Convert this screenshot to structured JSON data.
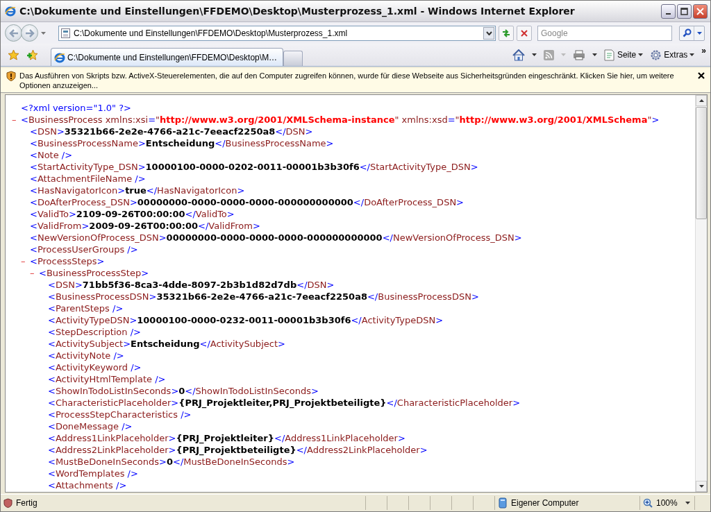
{
  "window": {
    "title": "C:\\Dokumente und Einstellungen\\FFDEMO\\Desktop\\Musterprozess_1.xml - Windows Internet Explorer"
  },
  "address_bar": {
    "value": "C:\\Dokumente und Einstellungen\\FFDEMO\\Desktop\\Musterprozess_1.xml"
  },
  "search": {
    "placeholder": "Google"
  },
  "tabs": [
    {
      "label": "C:\\Dokumente und Einstellungen\\FFDEMO\\Desktop\\M…",
      "selected": true
    }
  ],
  "command_bar": {
    "page_menu": "Seite",
    "tools_menu": "Extras",
    "overflow": "»"
  },
  "info_bar": {
    "message": "Das Ausführen von Skripts bzw. ActiveX-Steuerelementen, die auf den Computer zugreifen können, wurde für diese Webseite aus Sicherheitsgründen eingeschränkt. Klicken Sie hier, um weitere Optionen anzuzeigen..."
  },
  "xml": {
    "declaration": "<?xml version=\"1.0\" ?>",
    "root": {
      "toggle": "–",
      "expanded": true,
      "segments": [
        {
          "kind": "markup",
          "text": "<BusinessProcess xmlns:xsi=\""
        },
        {
          "kind": "attr_value",
          "text": "http://www.w3.org/2001/XMLSchema-instance"
        },
        {
          "kind": "markup",
          "text": "\" xmlns:xsd=\""
        },
        {
          "kind": "attr_value",
          "text": "http://www.w3.org/2001/XMLSchema"
        },
        {
          "kind": "markup",
          "text": "\">"
        }
      ],
      "children": [
        {
          "segments": [
            {
              "kind": "markup",
              "text": "<DSN>"
            },
            {
              "kind": "text",
              "text": "35321b66-2e2e-4766-a21c-7eeacf2250a8"
            },
            {
              "kind": "markup",
              "text": "</DSN>"
            }
          ]
        },
        {
          "segments": [
            {
              "kind": "markup",
              "text": "<BusinessProcessName>"
            },
            {
              "kind": "text",
              "text": "Entscheidung"
            },
            {
              "kind": "markup",
              "text": "</BusinessProcessName>"
            }
          ]
        },
        {
          "segments": [
            {
              "kind": "markup",
              "text": "<Note />"
            }
          ]
        },
        {
          "segments": [
            {
              "kind": "markup",
              "text": "<StartActivityType_DSN>"
            },
            {
              "kind": "text",
              "text": "10000100-0000-0202-0011-00001b3b30f6"
            },
            {
              "kind": "markup",
              "text": "</StartActivityType_DSN>"
            }
          ]
        },
        {
          "segments": [
            {
              "kind": "markup",
              "text": "<AttachmentFileName />"
            }
          ]
        },
        {
          "segments": [
            {
              "kind": "markup",
              "text": "<HasNavigatorIcon>"
            },
            {
              "kind": "text",
              "text": "true"
            },
            {
              "kind": "markup",
              "text": "</HasNavigatorIcon>"
            }
          ]
        },
        {
          "segments": [
            {
              "kind": "markup",
              "text": "<DoAfterProcess_DSN>"
            },
            {
              "kind": "text",
              "text": "00000000-0000-0000-0000-000000000000"
            },
            {
              "kind": "markup",
              "text": "</DoAfterProcess_DSN>"
            }
          ]
        },
        {
          "segments": [
            {
              "kind": "markup",
              "text": "<ValidTo>"
            },
            {
              "kind": "text",
              "text": "2109-09-26T00:00:00"
            },
            {
              "kind": "markup",
              "text": "</ValidTo>"
            }
          ]
        },
        {
          "segments": [
            {
              "kind": "markup",
              "text": "<ValidFrom>"
            },
            {
              "kind": "text",
              "text": "2009-09-26T00:00:00"
            },
            {
              "kind": "markup",
              "text": "</ValidFrom>"
            }
          ]
        },
        {
          "segments": [
            {
              "kind": "markup",
              "text": "<NewVersionOfProcess_DSN>"
            },
            {
              "kind": "text",
              "text": "00000000-0000-0000-0000-000000000000"
            },
            {
              "kind": "markup",
              "text": "</NewVersionOfProcess_DSN>"
            }
          ]
        },
        {
          "segments": [
            {
              "kind": "markup",
              "text": "<ProcessUserGroups />"
            }
          ]
        },
        {
          "toggle": "–",
          "expanded": true,
          "segments": [
            {
              "kind": "markup",
              "text": "<ProcessSteps>"
            }
          ],
          "children": [
            {
              "toggle": "–",
              "expanded": true,
              "segments": [
                {
                  "kind": "markup",
                  "text": "<BusinessProcessStep>"
                }
              ],
              "children": [
                {
                  "segments": [
                    {
                      "kind": "markup",
                      "text": "<DSN>"
                    },
                    {
                      "kind": "text",
                      "text": "71bb5f36-8ca3-4dde-8097-2b3b1d82d7db"
                    },
                    {
                      "kind": "markup",
                      "text": "</DSN>"
                    }
                  ]
                },
                {
                  "segments": [
                    {
                      "kind": "markup",
                      "text": "<BusinessProcessDSN>"
                    },
                    {
                      "kind": "text",
                      "text": "35321b66-2e2e-4766-a21c-7eeacf2250a8"
                    },
                    {
                      "kind": "markup",
                      "text": "</BusinessProcessDSN>"
                    }
                  ]
                },
                {
                  "segments": [
                    {
                      "kind": "markup",
                      "text": "<ParentSteps />"
                    }
                  ]
                },
                {
                  "segments": [
                    {
                      "kind": "markup",
                      "text": "<ActivityTypeDSN>"
                    },
                    {
                      "kind": "text",
                      "text": "10000100-0000-0232-0011-00001b3b30f6"
                    },
                    {
                      "kind": "markup",
                      "text": "</ActivityTypeDSN>"
                    }
                  ]
                },
                {
                  "segments": [
                    {
                      "kind": "markup",
                      "text": "<StepDescription />"
                    }
                  ]
                },
                {
                  "segments": [
                    {
                      "kind": "markup",
                      "text": "<ActivitySubject>"
                    },
                    {
                      "kind": "text",
                      "text": "Entscheidung"
                    },
                    {
                      "kind": "markup",
                      "text": "</ActivitySubject>"
                    }
                  ]
                },
                {
                  "segments": [
                    {
                      "kind": "markup",
                      "text": "<ActivityNote />"
                    }
                  ]
                },
                {
                  "segments": [
                    {
                      "kind": "markup",
                      "text": "<ActivityKeyword />"
                    }
                  ]
                },
                {
                  "segments": [
                    {
                      "kind": "markup",
                      "text": "<ActivityHtmlTemplate />"
                    }
                  ]
                },
                {
                  "segments": [
                    {
                      "kind": "markup",
                      "text": "<ShowInTodoListInSeconds>"
                    },
                    {
                      "kind": "text",
                      "text": "0"
                    },
                    {
                      "kind": "markup",
                      "text": "</ShowInTodoListInSeconds>"
                    }
                  ]
                },
                {
                  "segments": [
                    {
                      "kind": "markup",
                      "text": "<CharacteristicPlaceholder>"
                    },
                    {
                      "kind": "text",
                      "text": "{PRJ_Projektleiter,PRJ_Projektbeteiligte}"
                    },
                    {
                      "kind": "markup",
                      "text": "</CharacteristicPlaceholder>"
                    }
                  ]
                },
                {
                  "segments": [
                    {
                      "kind": "markup",
                      "text": "<ProcessStepCharacteristics />"
                    }
                  ]
                },
                {
                  "segments": [
                    {
                      "kind": "markup",
                      "text": "<DoneMessage />"
                    }
                  ]
                },
                {
                  "segments": [
                    {
                      "kind": "markup",
                      "text": "<Address1LinkPlaceholder>"
                    },
                    {
                      "kind": "text",
                      "text": "{PRJ_Projektleiter}"
                    },
                    {
                      "kind": "markup",
                      "text": "</Address1LinkPlaceholder>"
                    }
                  ]
                },
                {
                  "segments": [
                    {
                      "kind": "markup",
                      "text": "<Address2LinkPlaceholder>"
                    },
                    {
                      "kind": "text",
                      "text": "{PRJ_Projektbeteiligte}"
                    },
                    {
                      "kind": "markup",
                      "text": "</Address2LinkPlaceholder>"
                    }
                  ]
                },
                {
                  "segments": [
                    {
                      "kind": "markup",
                      "text": "<MustBeDoneInSeconds>"
                    },
                    {
                      "kind": "text",
                      "text": "0"
                    },
                    {
                      "kind": "markup",
                      "text": "</MustBeDoneInSeconds>"
                    }
                  ]
                },
                {
                  "segments": [
                    {
                      "kind": "markup",
                      "text": "<WordTemplates />"
                    }
                  ]
                },
                {
                  "segments": [
                    {
                      "kind": "markup",
                      "text": "<Attachments />"
                    }
                  ]
                }
              ]
            }
          ]
        }
      ]
    }
  },
  "status_bar": {
    "status": "Fertig",
    "zone": "Eigener Computer",
    "zoom": "100%"
  }
}
